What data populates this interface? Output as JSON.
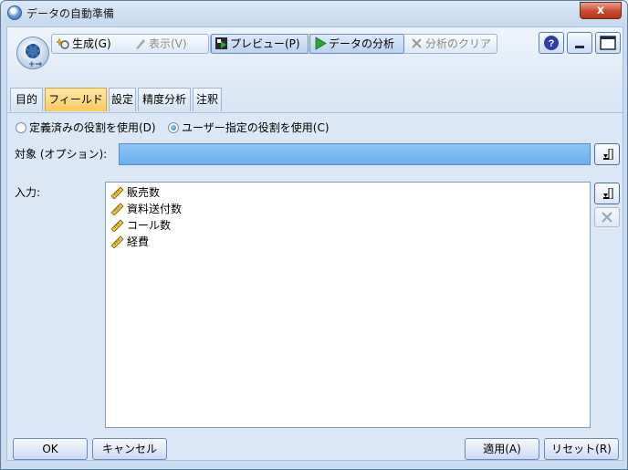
{
  "window": {
    "title": "データの自動準備",
    "close_label": "x"
  },
  "toolbar": {
    "generate": "生成(G)",
    "view": "表示(V)",
    "preview": "プレビュー(P)",
    "analyze": "データの分析",
    "clear_analysis": "分析のクリア",
    "help_label": "?"
  },
  "tabs": [
    {
      "label": "目的",
      "active": false
    },
    {
      "label": "フィールド",
      "active": true
    },
    {
      "label": "設定",
      "active": false
    },
    {
      "label": "精度分析",
      "active": false
    },
    {
      "label": "注釈",
      "active": false
    }
  ],
  "roles": {
    "predefined": "定義済みの役割を使用(D)",
    "custom": "ユーザー指定の役割を使用(C)",
    "selected": "custom"
  },
  "target": {
    "label": "対象 (オプション):",
    "value": ""
  },
  "inputs": {
    "label": "入力:",
    "fields": [
      "販売数",
      "資料送付数",
      "コール数",
      "経費"
    ]
  },
  "footer": {
    "ok": "OK",
    "cancel": "キャンセル",
    "apply": "適用(A)",
    "reset": "リセット(R)"
  },
  "colors": {
    "target_field": "#7ab9f2",
    "active_tab": "#fbc95b",
    "close_button": "#c74a2e"
  }
}
